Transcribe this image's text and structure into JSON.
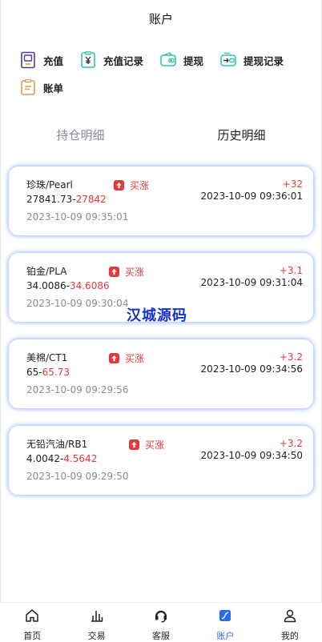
{
  "header": {
    "title": "账户"
  },
  "actions": [
    {
      "label": "充值",
      "icon": "deposit-icon"
    },
    {
      "label": "充值记录",
      "icon": "deposit-record-icon"
    },
    {
      "label": "提现",
      "icon": "wallet-withdraw-icon"
    },
    {
      "label": "提现记录",
      "icon": "withdraw-record-icon"
    },
    {
      "label": "账单",
      "icon": "bill-icon"
    }
  ],
  "tabs": [
    {
      "label": "持仓明细",
      "active": false
    },
    {
      "label": "历史明细",
      "active": true
    }
  ],
  "orders": [
    {
      "name": "珍珠/Pearl",
      "direction": "买涨",
      "open_price": "27841.73",
      "close_price": "27842",
      "open_time": "2023-10-09 09:35:01",
      "profit": "+32",
      "close_time": "2023-10-09 09:36:01"
    },
    {
      "name": "铂金/PLA",
      "direction": "买涨",
      "open_price": "34.0086",
      "close_price": "34.6086",
      "open_time": "2023-10-09 09:30:04",
      "profit": "+3.1",
      "close_time": "2023-10-09 09:31:04"
    },
    {
      "name": "美棉/CT1",
      "direction": "买涨",
      "open_price": "65",
      "close_price": "65.73",
      "open_time": "2023-10-09 09:29:56",
      "profit": "+3.2",
      "close_time": "2023-10-09 09:34:56"
    },
    {
      "name": "无铅汽油/RB1",
      "direction": "买涨",
      "open_price": "4.0042",
      "close_price": "4.5642",
      "open_time": "2023-10-09 09:29:50",
      "profit": "+3.2",
      "close_time": "2023-10-09 09:34:50"
    }
  ],
  "watermark": "汉城源码",
  "tabbar": [
    {
      "label": "首页",
      "icon": "home-icon",
      "active": false
    },
    {
      "label": "交易",
      "icon": "chart-icon",
      "active": false
    },
    {
      "label": "客服",
      "icon": "headset-icon",
      "active": false
    },
    {
      "label": "账户",
      "icon": "account-icon",
      "active": true
    },
    {
      "label": "我的",
      "icon": "user-icon",
      "active": false
    }
  ],
  "colors": {
    "accent": "#2a6cf0",
    "rise": "#e4393c",
    "teal": "#2bc9a5",
    "purple": "#4a3fa0",
    "orange": "#e09a4e"
  }
}
